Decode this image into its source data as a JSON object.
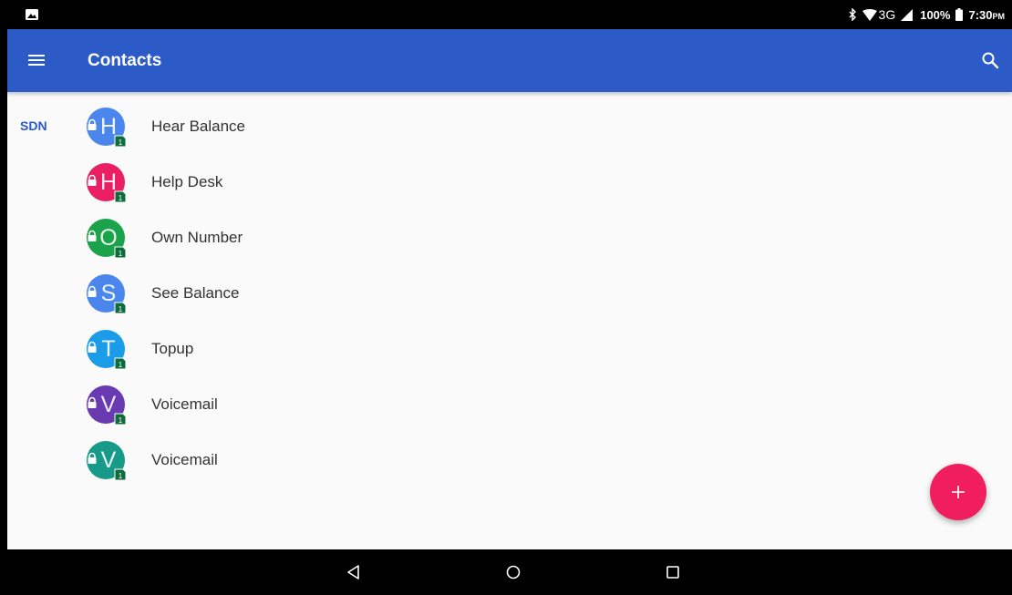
{
  "status_bar": {
    "battery": "100%",
    "time": "7:30",
    "time_suffix": "PM",
    "network": "3G",
    "icons": [
      "image-notification-icon",
      "bluetooth-icon",
      "wifi-icon",
      "signal-icon",
      "battery-icon"
    ]
  },
  "app_bar": {
    "title": "Contacts",
    "menu_icon": "hamburger-menu-icon",
    "search_icon": "search-icon",
    "color": "#2c5ac6"
  },
  "section": {
    "label": "SDN"
  },
  "contacts": [
    {
      "initial": "H",
      "name": "Hear Balance",
      "color": "#4a86ec"
    },
    {
      "initial": "H",
      "name": "Help Desk",
      "color": "#ea1f63"
    },
    {
      "initial": "O",
      "name": "Own Number",
      "color": "#1aa34a"
    },
    {
      "initial": "S",
      "name": "See Balance",
      "color": "#4a86ec"
    },
    {
      "initial": "T",
      "name": "Topup",
      "color": "#1a9ce8"
    },
    {
      "initial": "V",
      "name": "Voicemail",
      "color": "#6a3ab2"
    },
    {
      "initial": "V",
      "name": "Voicemail",
      "color": "#179a88"
    }
  ],
  "fab": {
    "icon": "plus-icon",
    "color": "#f01d5f"
  },
  "nav_bar": {
    "icons": [
      "back-icon",
      "home-icon",
      "recents-icon"
    ]
  }
}
